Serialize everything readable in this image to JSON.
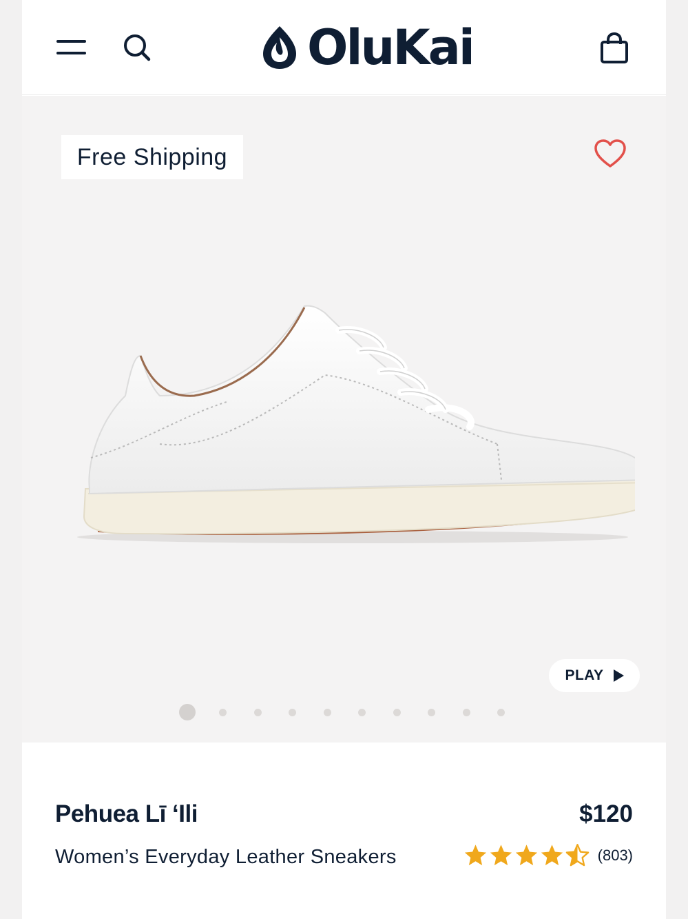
{
  "header": {
    "logo_text": "OluKai",
    "menu_icon": "hamburger-menu-icon",
    "search_icon": "search-icon",
    "cart_icon": "shopping-bag-icon"
  },
  "gallery": {
    "badge_text": "Free Shipping",
    "favorite_icon": "heart-outline-icon",
    "play_label": "PLAY",
    "slide_count": 10,
    "active_slide": 1
  },
  "product": {
    "name": "Pehuea Lī ‘Ili",
    "price": "$120",
    "subtitle": "Women’s Everyday Leather Sneakers",
    "rating": 4.5,
    "review_count": "(803)"
  },
  "colors": {
    "brand": "#0f1e33",
    "heart": "#e2504a",
    "star": "#f0a81c"
  }
}
